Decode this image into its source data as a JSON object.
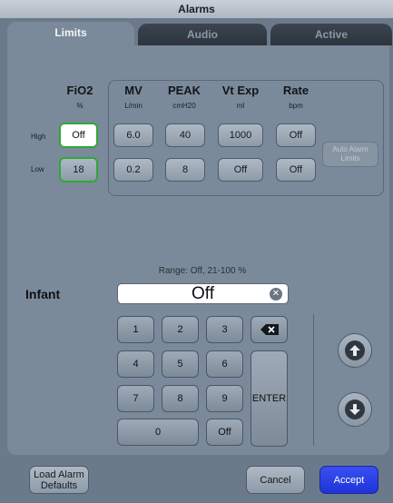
{
  "window": {
    "title": "Alarms"
  },
  "tabs": [
    {
      "label": "Limits",
      "active": true
    },
    {
      "label": "Audio",
      "active": false
    },
    {
      "label": "Active",
      "active": false
    }
  ],
  "limits": {
    "columns": [
      {
        "name": "FiO2",
        "unit": "%",
        "high": "Off",
        "low": "18"
      },
      {
        "name": "MV",
        "unit": "L/min",
        "high": "6.0",
        "low": "0.2"
      },
      {
        "name": "PEAK",
        "unit": "cmH20",
        "high": "40",
        "low": "8"
      },
      {
        "name": "Vt Exp",
        "unit": "ml",
        "high": "1000",
        "low": "Off"
      },
      {
        "name": "Rate",
        "unit": "bpm",
        "high": "Off",
        "low": "Off"
      }
    ],
    "row_high": "High",
    "row_low": "Low",
    "auto_button": "Auto Alarm Limits"
  },
  "entry": {
    "range_text": "Range: Off, 21-100 %",
    "patient_type": "Infant",
    "value": "Off"
  },
  "keypad": {
    "keys": [
      "1",
      "2",
      "3",
      "4",
      "5",
      "6",
      "7",
      "8",
      "9",
      "0",
      "Off"
    ],
    "enter": "ENTER"
  },
  "icons": {
    "clear": "clear-circle-icon",
    "backspace": "backspace-icon",
    "up": "arrow-up-icon",
    "down": "arrow-down-icon"
  },
  "footer": {
    "load_defaults": "Load Alarm Defaults",
    "cancel": "Cancel",
    "accept": "Accept"
  },
  "colors": {
    "panel": "#7b8a9a",
    "selected_border": "#2fa73a",
    "accept": "#2a3fe6"
  }
}
